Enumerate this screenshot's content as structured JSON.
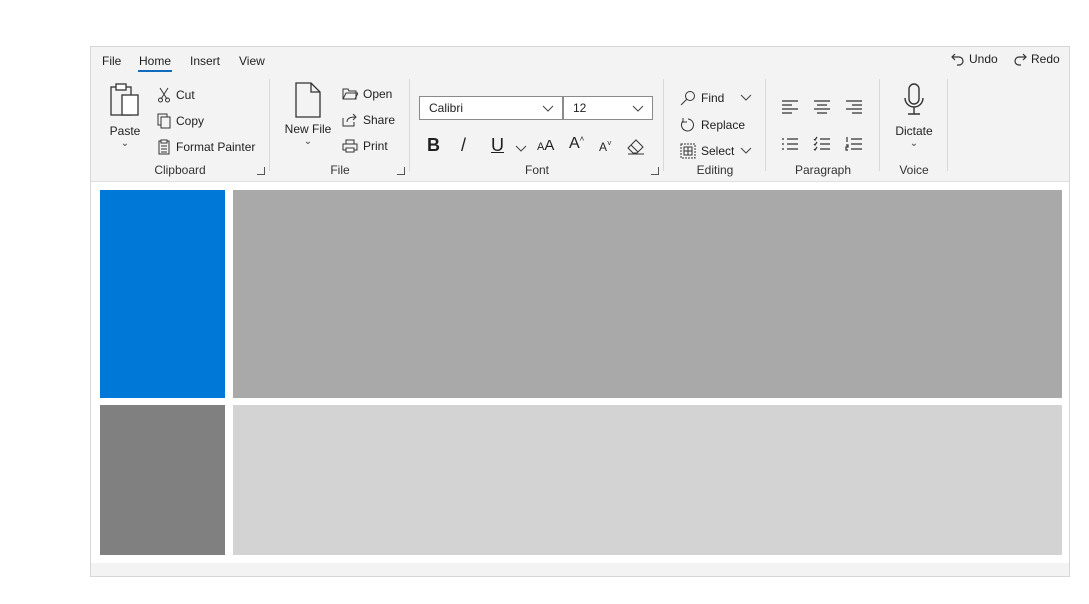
{
  "tabs": {
    "file": "File",
    "home": "Home",
    "insert": "Insert",
    "view": "View"
  },
  "quick_access": {
    "undo": "Undo",
    "redo": "Redo"
  },
  "clipboard": {
    "paste": "Paste",
    "cut": "Cut",
    "copy": "Copy",
    "format_painter": "Format Painter",
    "label": "Clipboard"
  },
  "file_group": {
    "new_file": "New File",
    "open": "Open",
    "share": "Share",
    "print": "Print",
    "label": "File"
  },
  "font": {
    "family": "Calibri",
    "size": "12",
    "bold": "B",
    "italic": "/",
    "underline": "U",
    "label": "Font"
  },
  "editing": {
    "find": "Find",
    "replace": "Replace",
    "select": "Select",
    "label": "Editing"
  },
  "paragraph": {
    "label": "Paragraph"
  },
  "voice": {
    "dictate": "Dictate",
    "label": "Voice"
  },
  "colors": {
    "accent": "#0078d7",
    "block_dark": "#a9a9a9",
    "block_gray": "#808080",
    "block_light": "#d3d3d3",
    "ribbon_bg": "#f3f3f3"
  }
}
